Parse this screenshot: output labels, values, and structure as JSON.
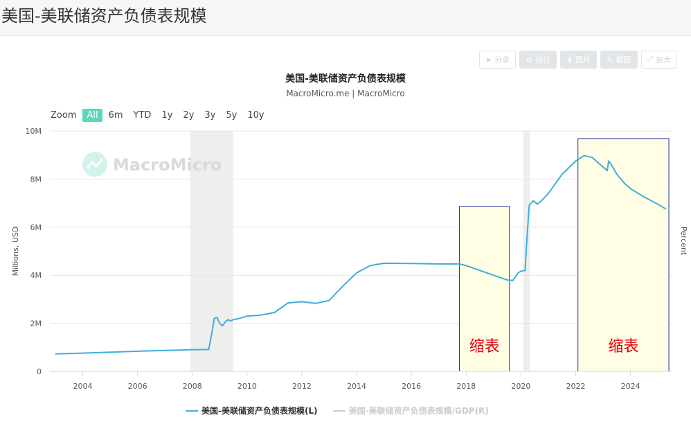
{
  "page": {
    "title": "美国-美联储资产负债表规模"
  },
  "toolbar": {
    "share": "分享",
    "subscribe": "自订",
    "image": "图片",
    "edit": "截图",
    "fullscreen": "放大"
  },
  "chart": {
    "title": "美国-美联储资产负债表规模",
    "subtitle": "MacroMicro.me | MacroMicro",
    "watermark": "MacroMicro",
    "zoom_label": "Zoom",
    "zoom_options": [
      "All",
      "6m",
      "YTD",
      "1y",
      "2y",
      "3y",
      "5y",
      "10y"
    ],
    "zoom_selected": "All",
    "ylabel_left": "Millions, USD",
    "ylabel_right": "Percent",
    "annotations": [
      "缩表",
      "缩表"
    ],
    "legend": [
      "美国-美联储资产负债表规模(L)",
      "美国-美联储资产负债表规模/GDP(R)"
    ]
  },
  "colors": {
    "series": "#3eaed8",
    "series_inactive": "#cccccc",
    "recession": "#eeeeee",
    "annotation_fill": "#fffde3",
    "annotation_border": "#1a2b9c",
    "annotation_text": "#e0000d",
    "zoom_active": "#5fd6be"
  },
  "chart_data": {
    "type": "line",
    "title": "美国-美联储资产负债表规模",
    "subtitle": "MacroMicro.me | MacroMicro",
    "ylabel": "Millions, USD",
    "ylabel_right": "Percent",
    "xlim": [
      2002.8,
      2025.5
    ],
    "ylim": [
      0,
      10000000
    ],
    "x_ticks": [
      "2004",
      "2006",
      "2008",
      "2010",
      "2012",
      "2014",
      "2016",
      "2018",
      "2020",
      "2022",
      "2024"
    ],
    "y_ticks": [
      "0",
      "2M",
      "4M",
      "6M",
      "8M",
      "10M"
    ],
    "grid": true,
    "legend_position": "bottom",
    "recessions": [
      [
        2007.92,
        2009.5
      ],
      [
        2020.08,
        2020.33
      ]
    ],
    "highlight_ranges": [
      {
        "label": "缩表",
        "x": [
          2017.75,
          2019.58
        ]
      },
      {
        "label": "缩表",
        "x": [
          2022.08,
          2025.4
        ]
      }
    ],
    "series": [
      {
        "name": "美国-美联储资产负债表规模(L)",
        "x": [
          2003.0,
          2004.0,
          2005.0,
          2006.0,
          2007.0,
          2007.9,
          2008.6,
          2008.7,
          2008.8,
          2008.9,
          2009.0,
          2009.1,
          2009.2,
          2009.3,
          2009.4,
          2009.5,
          2009.7,
          2010.0,
          2010.5,
          2011.0,
          2011.5,
          2012.0,
          2012.5,
          2013.0,
          2013.5,
          2014.0,
          2014.5,
          2015.0,
          2016.0,
          2017.0,
          2017.75,
          2018.0,
          2018.5,
          2019.0,
          2019.5,
          2019.7,
          2019.9,
          2020.0,
          2020.15,
          2020.2,
          2020.3,
          2020.45,
          2020.6,
          2020.75,
          2021.0,
          2021.5,
          2022.0,
          2022.3,
          2022.6,
          2023.0,
          2023.15,
          2023.2,
          2023.3,
          2023.5,
          2023.8,
          2024.0,
          2024.5,
          2025.0,
          2025.3
        ],
        "values": [
          730000,
          760000,
          800000,
          840000,
          870000,
          900000,
          910000,
          1500000,
          2200000,
          2250000,
          2000000,
          1900000,
          2050000,
          2150000,
          2100000,
          2150000,
          2200000,
          2300000,
          2340000,
          2450000,
          2850000,
          2900000,
          2830000,
          2950000,
          3550000,
          4100000,
          4400000,
          4500000,
          4490000,
          4470000,
          4470000,
          4400000,
          4200000,
          4000000,
          3800000,
          3780000,
          4100000,
          4170000,
          4200000,
          5200000,
          6900000,
          7100000,
          6950000,
          7100000,
          7400000,
          8200000,
          8750000,
          8970000,
          8900000,
          8500000,
          8350000,
          8750000,
          8600000,
          8200000,
          7800000,
          7600000,
          7250000,
          6950000,
          6750000
        ]
      },
      {
        "name": "美国-美联储资产负债表规模/GDP(R)",
        "x": [],
        "values": []
      }
    ]
  }
}
